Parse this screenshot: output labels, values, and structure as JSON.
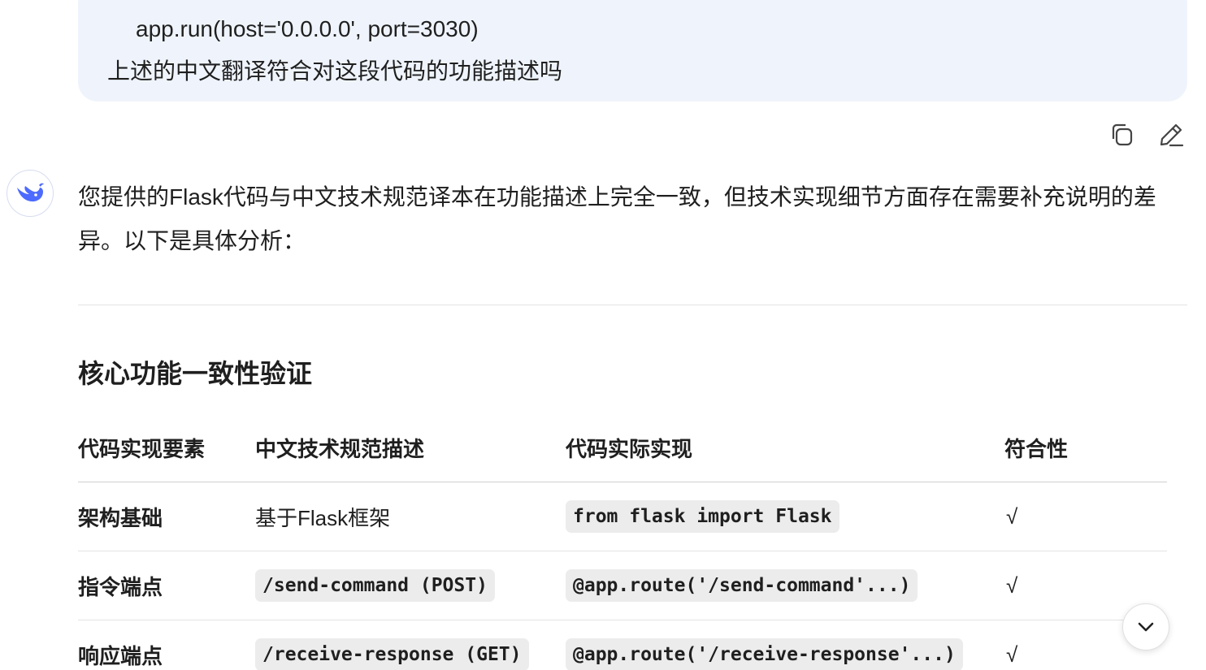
{
  "user_message": {
    "code_tail": "app.run(host='0.0.0.0', port=3030)",
    "question": "上述的中文翻译符合对这段代码的功能描述吗"
  },
  "message_actions": {
    "copy_icon": "copy-icon",
    "edit_icon": "edit-icon"
  },
  "assistant": {
    "avatar_icon": "deepseek-whale-icon",
    "intro": "您提供的Flask代码与中文技术规范译本在功能描述上完全一致，但技术实现细节方面存在需要补充说明的差异。以下是具体分析：",
    "section_heading": "核心功能一致性验证",
    "table": {
      "headers": [
        "代码实现要素",
        "中文技术规范描述",
        "代码实际实现",
        "符合性"
      ],
      "rows": [
        {
          "element": "架构基础",
          "spec": "基于Flask框架",
          "spec_is_code": false,
          "impl": "from flask import Flask",
          "check": "√"
        },
        {
          "element": "指令端点",
          "spec": "/send-command (POST)",
          "spec_is_code": true,
          "impl": "@app.route('/send-command'...)",
          "check": "√"
        },
        {
          "element": "响应端点",
          "spec": "/receive-response (GET)",
          "spec_is_code": true,
          "impl": "@app.route('/receive-response'...)",
          "check": "√"
        }
      ]
    }
  },
  "scroll_button": {
    "icon": "chevron-down-icon"
  },
  "colors": {
    "user_bubble_bg": "#eff4fc",
    "text": "#1f1f1f",
    "code_bg": "#ececec",
    "avatar_accent": "#4d6bfe"
  }
}
